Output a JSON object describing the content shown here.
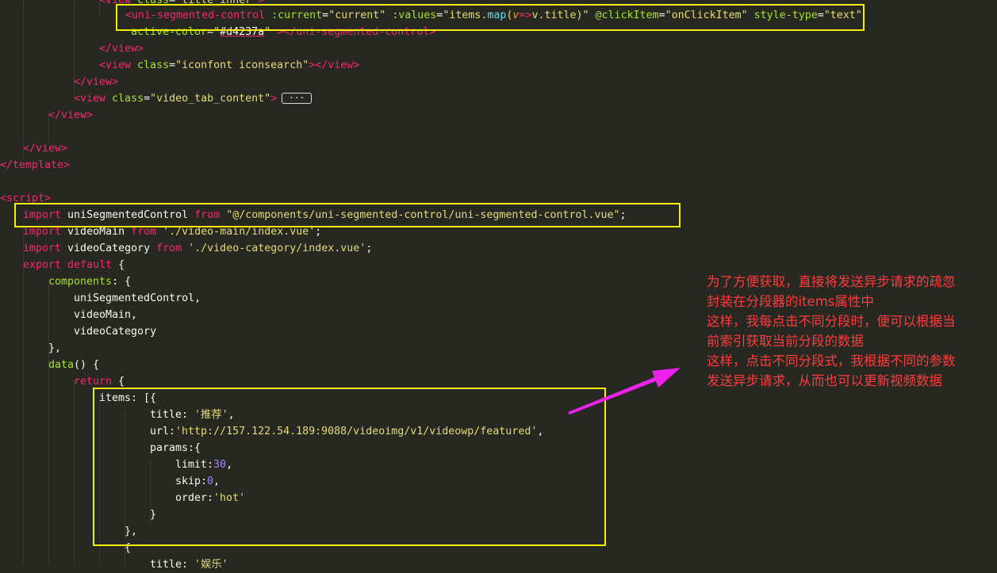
{
  "editor": {
    "background": "#272822",
    "lines": [
      {
        "tokens": [
          [
            "t-tag",
            "<view "
          ],
          [
            "t-attr",
            "class"
          ],
          [
            "t-plain",
            "="
          ],
          [
            "t-str",
            "\"title_inner\""
          ],
          [
            "t-tag",
            ">"
          ]
        ]
      },
      {
        "tokens": [
          [
            "t-tag",
            "<uni-segmented-control "
          ],
          [
            "t-attr",
            ":current"
          ],
          [
            "t-plain",
            "="
          ],
          [
            "t-str",
            "\"current\" "
          ],
          [
            "t-attr",
            ":values"
          ],
          [
            "t-plain",
            "="
          ],
          [
            "t-str",
            "\"items."
          ],
          [
            "t-fn",
            "map"
          ],
          [
            "t-str",
            "("
          ],
          [
            "t-param",
            "v"
          ],
          [
            "t-kw",
            "=>"
          ],
          [
            "t-str",
            "v.title)\" "
          ],
          [
            "t-attr",
            "@clickItem"
          ],
          [
            "t-plain",
            "="
          ],
          [
            "t-str",
            "\"onClickItem\" "
          ],
          [
            "t-attr",
            "style-type"
          ],
          [
            "t-plain",
            "="
          ],
          [
            "t-str",
            "\"text\""
          ]
        ]
      },
      {
        "tokens": [
          [
            "t-attr",
            "active-color"
          ],
          [
            "t-plain",
            "="
          ],
          [
            "t-str",
            "\""
          ],
          [
            "t-color",
            "#d4237a"
          ],
          [
            "t-str",
            "\" "
          ],
          [
            "t-tag",
            ">"
          ],
          [
            "t-tag",
            "</uni-segmented-control>"
          ]
        ]
      },
      {
        "tokens": [
          [
            "t-tag",
            "</view>"
          ]
        ]
      },
      {
        "tokens": [
          [
            "t-tag",
            "<view "
          ],
          [
            "t-attr",
            "class"
          ],
          [
            "t-plain",
            "="
          ],
          [
            "t-str",
            "\"iconfont iconsearch\""
          ],
          [
            "t-tag",
            ">"
          ],
          [
            "t-tag",
            "</view>"
          ]
        ]
      },
      {
        "tokens": [
          [
            "t-tag",
            "</view>"
          ]
        ]
      },
      {
        "tokens": [
          [
            "t-tag",
            "<view "
          ],
          [
            "t-attr",
            "class"
          ],
          [
            "t-plain",
            "="
          ],
          [
            "t-str",
            "\"video_tab_content\""
          ],
          [
            "t-tag",
            ">"
          ]
        ],
        "fold": "···"
      },
      {
        "tokens": [
          [
            "t-tag",
            "</view>"
          ]
        ]
      },
      {
        "tokens": []
      },
      {
        "tokens": [
          [
            "t-tag",
            "</view>"
          ]
        ]
      },
      {
        "tokens": [
          [
            "t-tag",
            "</template>"
          ]
        ]
      },
      {
        "tokens": []
      },
      {
        "tokens": [
          [
            "t-tag",
            "<script>"
          ]
        ]
      },
      {
        "tokens": [
          [
            "t-kw",
            "import "
          ],
          [
            "t-plain",
            "uniSegmentedControl "
          ],
          [
            "t-kw",
            "from "
          ],
          [
            "t-str",
            "\"@/components/uni-segmented-control/uni-segmented-control.vue\""
          ],
          [
            "t-plain",
            ";"
          ]
        ]
      },
      {
        "tokens": [
          [
            "t-kw",
            "import "
          ],
          [
            "t-plain",
            "videoMain "
          ],
          [
            "t-kw",
            "from "
          ],
          [
            "t-str",
            "'./video-main/index.vue'"
          ],
          [
            "t-plain",
            ";"
          ]
        ]
      },
      {
        "tokens": [
          [
            "t-kw",
            "import "
          ],
          [
            "t-plain",
            "videoCategory "
          ],
          [
            "t-kw",
            "from "
          ],
          [
            "t-str",
            "'./video-category/index.vue'"
          ],
          [
            "t-plain",
            ";"
          ]
        ]
      },
      {
        "tokens": [
          [
            "t-kw",
            "export "
          ],
          [
            "t-kw",
            "default "
          ],
          [
            "t-plain",
            "{"
          ]
        ]
      },
      {
        "tokens": [
          [
            "t-attr",
            "components"
          ],
          [
            "t-plain",
            ": {"
          ]
        ]
      },
      {
        "tokens": [
          [
            "t-plain",
            "uniSegmentedControl,"
          ]
        ]
      },
      {
        "tokens": [
          [
            "t-plain",
            "videoMain,"
          ]
        ]
      },
      {
        "tokens": [
          [
            "t-plain",
            "videoCategory"
          ]
        ]
      },
      {
        "tokens": [
          [
            "t-plain",
            "},"
          ]
        ]
      },
      {
        "tokens": [
          [
            "t-attr",
            "data"
          ],
          [
            "t-plain",
            "() {"
          ]
        ]
      },
      {
        "tokens": [
          [
            "t-kw",
            "return "
          ],
          [
            "t-plain",
            "{"
          ]
        ]
      },
      {
        "tokens": [
          [
            "t-plain",
            "items: [{"
          ]
        ]
      },
      {
        "tokens": [
          [
            "t-plain",
            "title: "
          ],
          [
            "t-str",
            "'推荐'"
          ],
          [
            "t-plain",
            ","
          ]
        ]
      },
      {
        "tokens": [
          [
            "t-plain",
            "url:"
          ],
          [
            "t-str",
            "'http://157.122.54.189:9088/videoimg/v1/videowp/featured'"
          ],
          [
            "t-plain",
            ","
          ]
        ]
      },
      {
        "tokens": [
          [
            "t-plain",
            "params:{"
          ]
        ]
      },
      {
        "tokens": [
          [
            "t-plain",
            "limit:"
          ],
          [
            "t-num",
            "30"
          ],
          [
            "t-plain",
            ","
          ]
        ]
      },
      {
        "tokens": [
          [
            "t-plain",
            "skip:"
          ],
          [
            "t-num",
            "0"
          ],
          [
            "t-plain",
            ","
          ]
        ]
      },
      {
        "tokens": [
          [
            "t-plain",
            "order:"
          ],
          [
            "t-str",
            "'hot'"
          ]
        ]
      },
      {
        "tokens": [
          [
            "t-plain",
            "}"
          ]
        ]
      },
      {
        "tokens": [
          [
            "t-plain",
            "},"
          ]
        ]
      },
      {
        "tokens": [
          [
            "t-plain",
            "{"
          ]
        ]
      },
      {
        "tokens": [
          [
            "t-plain",
            "title: "
          ],
          [
            "t-str",
            "'娱乐'"
          ]
        ]
      }
    ]
  },
  "annotation": {
    "color": "#ff3b3b",
    "lines": [
      "为了方便获取，直接将发送异步请求的疏忽",
      "封装在分段器的items属性中",
      "这样，我每点击不同分段时，便可以根据当",
      "前索引获取当前分段的数据",
      "这样，点击不同分段式，我根据不同的参数",
      "发送异步请求，从而也可以更新视频数据"
    ]
  },
  "highlight_color": "#f5f000",
  "arrow_color": "#ee22ee"
}
